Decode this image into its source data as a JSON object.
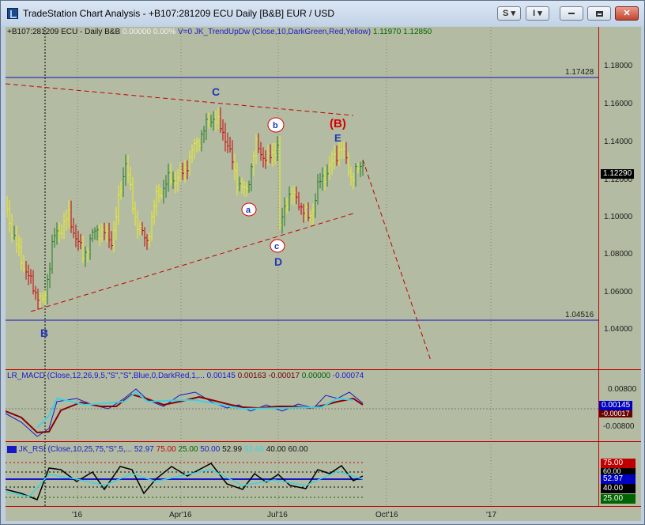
{
  "window": {
    "title": "TradeStation Chart Analysis - +B107:281209 ECU Daily [B&B] EUR / USD",
    "buttons": {
      "s": "S",
      "i": "I"
    }
  },
  "price_header": {
    "symbol": "+B107:281209 ECU - Daily  B&B",
    "change": "0.00000",
    "pct": "0.00%",
    "volume": "V=0",
    "indicator": "JK_TrendUpDw (Close,10,DarkGreen,Red,Yellow)",
    "val1": "1.11970",
    "val2": "1.12850"
  },
  "macd_header": {
    "label": "LR_MACD (Close,12,26,9,5,\"S\",\"S\",Blue,0,DarkRed,1,...",
    "v1": "0.00145",
    "v2": "0.00163",
    "v3": "-0.00017",
    "v4": "0.00000",
    "v5": "-0.00074"
  },
  "rsi_header": {
    "label": "JK_RSI (Close,10,25,75,\"S\",5,...",
    "v1": "52.97",
    "v2": "75.00",
    "v3": "25.00",
    "v4": "50.00",
    "v5": "52.99",
    "v6": "52.66",
    "v7": "40.00",
    "v8": "60.00"
  },
  "price_axis": {
    "ticks": [
      "1.18000",
      "1.16000",
      "1.14000",
      "1.12000",
      "1.10000",
      "1.08000",
      "1.06000",
      "1.04000"
    ],
    "hline_high": "1.17428",
    "hline_low": "1.04516",
    "last_price": "1.12290"
  },
  "macd_axis": {
    "ticks": [
      "0.00800",
      "-0.00800"
    ],
    "last": "0.00145",
    "neg": "-0.00017"
  },
  "rsi_axis": {
    "tags": [
      "75.00",
      "60.00",
      "52.97",
      "40.00",
      "25.00"
    ]
  },
  "time_axis": [
    "'16",
    "Apr'16",
    "Jul'16",
    "Oct'16",
    "'17"
  ],
  "wave_labels": {
    "A": "B",
    "C": "C",
    "D": "D",
    "E": "E",
    "B2": "(B)",
    "a": "a",
    "b": "b",
    "c": "c"
  },
  "colors": {
    "background": "#b3bca3",
    "up": "#1e7d1e",
    "down": "#c40000",
    "neutral": "#eeee22",
    "wave_label": "#1f36b8",
    "trend_line": "#c00000",
    "hline": "#1010c0"
  },
  "chart_data": {
    "type": "candlestick",
    "symbol": "EUR / USD",
    "interval": "Daily",
    "ylim": [
      1.03,
      1.19
    ],
    "horizontal_lines": [
      1.17428,
      1.04516
    ],
    "last_price": 1.1229,
    "wave_points": [
      {
        "label": "B",
        "date": "2016-01",
        "price": 1.052
      },
      {
        "label": "C",
        "date": "2016-05",
        "price": 1.162
      },
      {
        "label": "a",
        "date": "2016-06",
        "price": 1.105
      },
      {
        "label": "b",
        "date": "2016-06",
        "price": 1.142
      },
      {
        "label": "c",
        "date": "2016-06",
        "price": 1.09
      },
      {
        "label": "D",
        "date": "2016-06",
        "price": 1.09
      },
      {
        "label": "E",
        "date": "2016-08",
        "price": 1.137
      },
      {
        "label": "(B)",
        "date": "2016-08",
        "price": 1.137
      }
    ]
  }
}
